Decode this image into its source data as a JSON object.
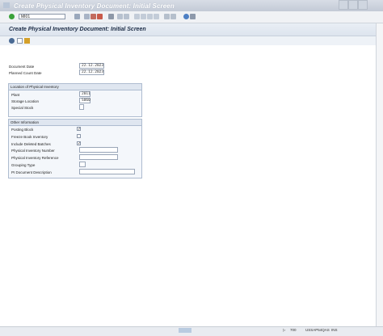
{
  "window": {
    "title": "Create Physical Inventory Document: Initial Screen"
  },
  "toolbar": {
    "command_value": "MI01"
  },
  "screen": {
    "title": "Create Physical Inventory Document: Initial Screen"
  },
  "header_fields": {
    "document_date_label": "Document Date",
    "document_date_value": "22.12.2023",
    "planned_count_date_label": "Planned Count Date",
    "planned_count_date_value": "22.12.2023"
  },
  "location_group": {
    "title": "Location of Physical Inventory",
    "plant_label": "Plant",
    "plant_value": "2011",
    "storage_location_label": "Storage Location",
    "storage_location_value": "S060",
    "special_stock_label": "Special Stock",
    "special_stock_value": ""
  },
  "other_group": {
    "title": "Other Information",
    "posting_block_label": "Posting Block",
    "posting_block_checked": "✓",
    "freeze_book_label": "Freeze Book Inventory",
    "freeze_book_checked": "",
    "include_deleted_label": "Include Deleted Batches",
    "include_deleted_checked": "✓",
    "pi_number_label": "Physical Inventory Number",
    "pi_reference_label": "Physical Inventory Reference",
    "grouping_type_label": "Grouping Type",
    "fi_doc_desc_label": "PI Document Description"
  },
  "status_bar": {
    "client": "700",
    "system": "USSAP54QAS",
    "mode": "INS"
  }
}
